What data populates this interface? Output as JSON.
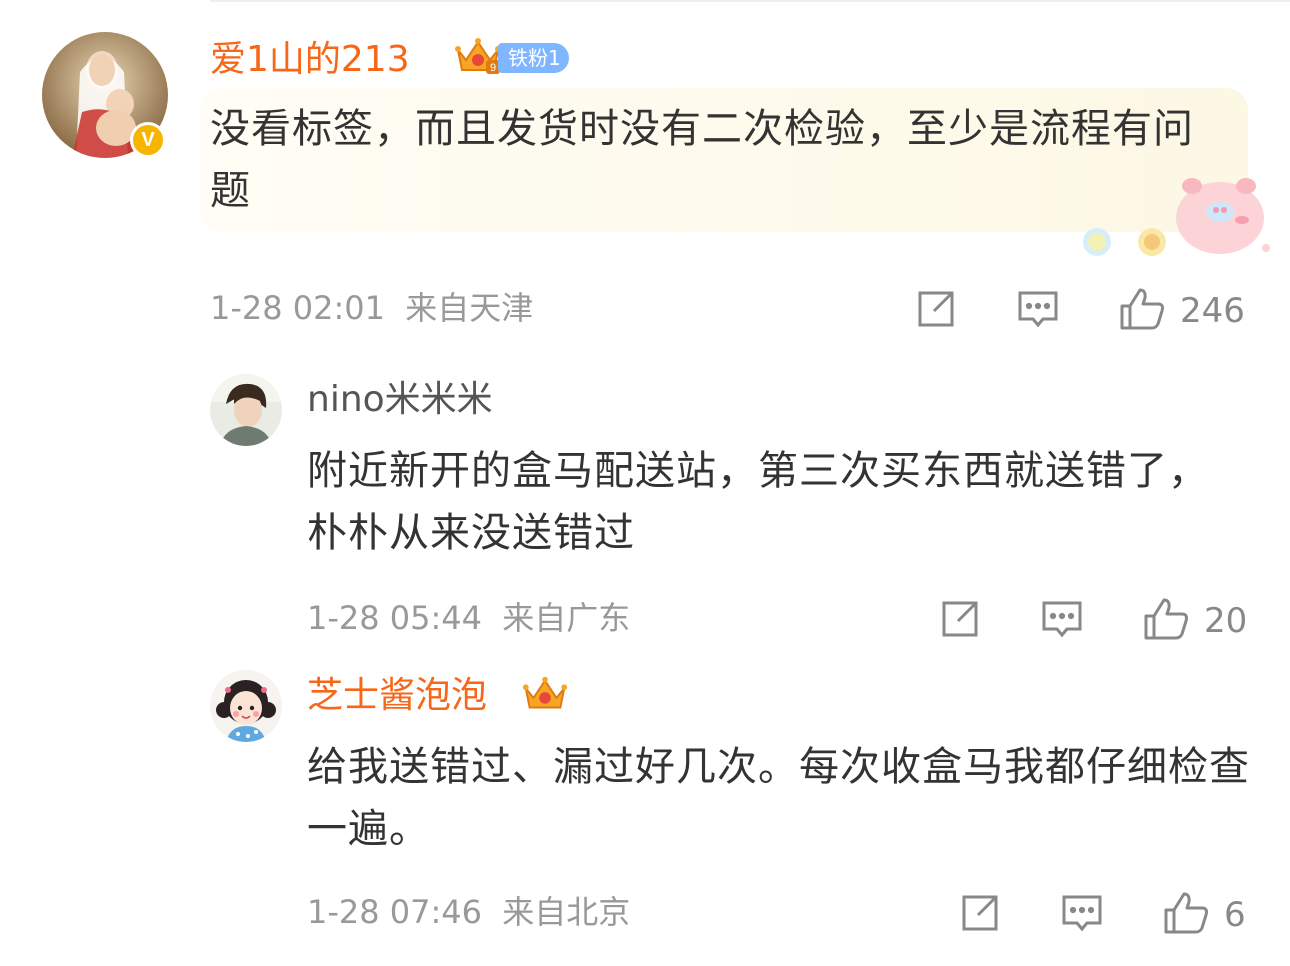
{
  "comments": [
    {
      "user": "爱1山的213",
      "fan_badge": "铁粉1",
      "text": "没看标签，而且发货时没有二次检验，至少是流程有问题",
      "time": "1-28 02:01",
      "location": "来自天津",
      "likes": "246"
    },
    {
      "user": "nino米米米",
      "text": "附近新开的盒马配送站，第三次买东西就送错了，朴朴从来没送错过",
      "time": "1-28 05:44",
      "location": "来自广东",
      "likes": "20"
    },
    {
      "user": "芝士酱泡泡",
      "text": "给我送错过、漏过好几次。每次收盒马我都仔细检查一遍。",
      "time": "1-28 07:46",
      "location": "来自北京",
      "likes": "6"
    }
  ],
  "verified_badge": "V",
  "colors": {
    "name_highlight": "#f86617",
    "meta": "#999999",
    "fan_badge": "#7fb6ff"
  },
  "icons": [
    "share-icon",
    "comment-icon",
    "like-icon",
    "crown-icon"
  ]
}
